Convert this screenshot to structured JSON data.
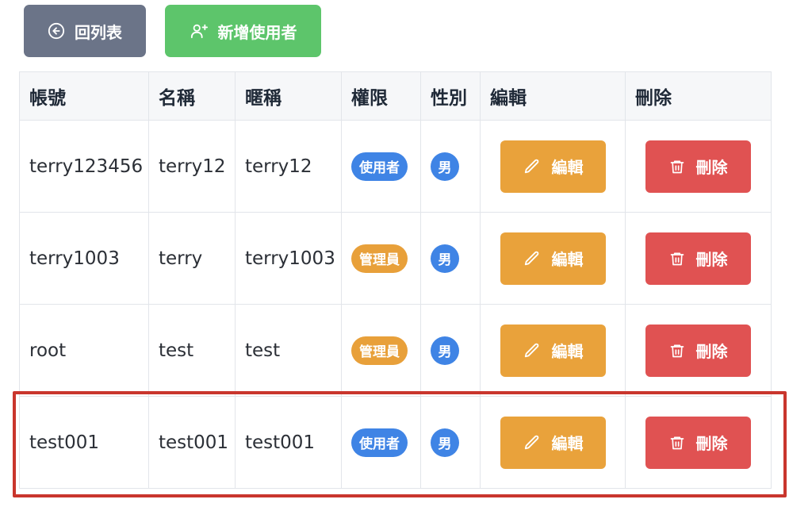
{
  "toolbar": {
    "back_label": "回列表",
    "add_label": "新增使用者"
  },
  "table": {
    "headers": [
      "帳號",
      "名稱",
      "暱稱",
      "權限",
      "性別",
      "編輯",
      "刪除"
    ],
    "edit_label": "編輯",
    "delete_label": "刪除",
    "rows": [
      {
        "account": "terry123456",
        "name": "terry12",
        "nickname": "terry12",
        "role": "使用者",
        "role_type": "user",
        "gender": "男"
      },
      {
        "account": "terry1003",
        "name": "terry",
        "nickname": "terry1003",
        "role": "管理員",
        "role_type": "admin",
        "gender": "男"
      },
      {
        "account": "root",
        "name": "test",
        "nickname": "test",
        "role": "管理員",
        "role_type": "admin",
        "gender": "男"
      },
      {
        "account": "test001",
        "name": "test001",
        "nickname": "test001",
        "role": "使用者",
        "role_type": "user",
        "gender": "男"
      }
    ]
  },
  "colors": {
    "back_button": "#6b7488",
    "add_button": "#5dc56b",
    "user_badge": "#3f84e5",
    "admin_badge": "#e8a03a",
    "edit_button": "#e9a23b",
    "delete_button": "#e05252",
    "highlight": "#c9362d"
  },
  "icons": {
    "back": "arrow-left-circle-icon",
    "add": "user-plus-icon",
    "edit": "pencil-icon",
    "delete": "trash-icon"
  }
}
